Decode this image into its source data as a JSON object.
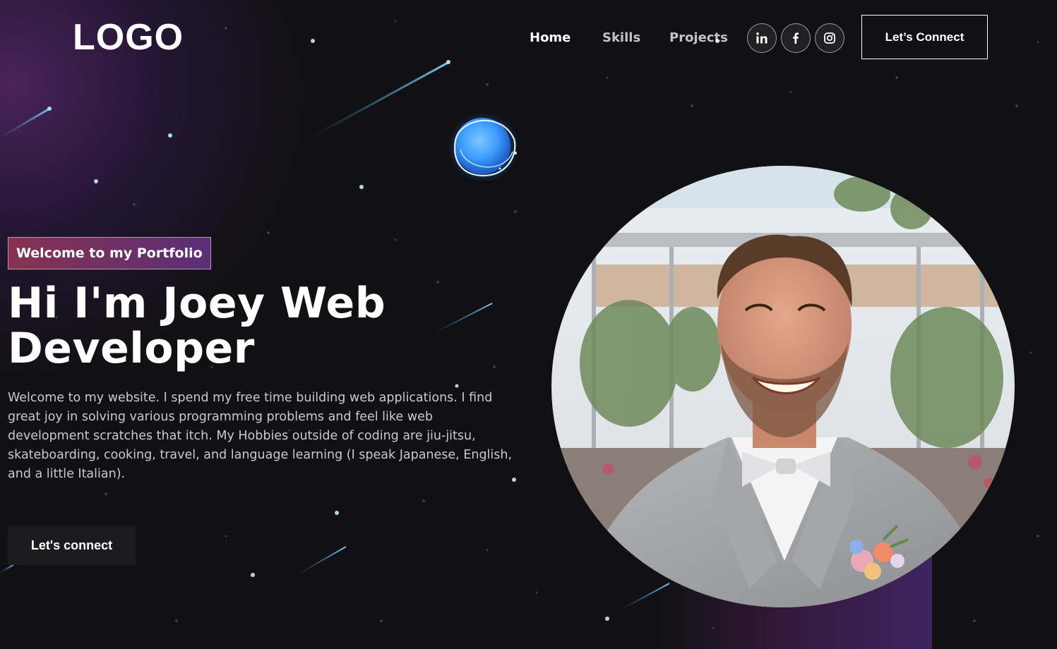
{
  "nav": {
    "logo": "LOGO",
    "links": [
      "Home",
      "Skills",
      "Projects"
    ],
    "social": [
      "linkedin-icon",
      "facebook-icon",
      "instagram-icon"
    ],
    "connect_label": "Let’s Connect"
  },
  "hero": {
    "tagline": "Welcome to my Portfolio",
    "headline_line1": "Hi I'm Joey Web",
    "headline_line2": "Developer",
    "intro": "Welcome to my website. I spend my free time building web applications. I find great joy in solving various programming problems and feel like web development scratches that itch. My Hobbies outside of coding are jiu-jitsu, skateboarding, cooking, travel, and language learning (I speak Japanese, English, and a little Italian).",
    "cta_label": "Let's connect"
  },
  "colors": {
    "background": "#111113",
    "tagline_gradient_start": "#88324f",
    "tagline_gradient_end": "#5a2e78",
    "accent_blue": "#3b9cff"
  }
}
